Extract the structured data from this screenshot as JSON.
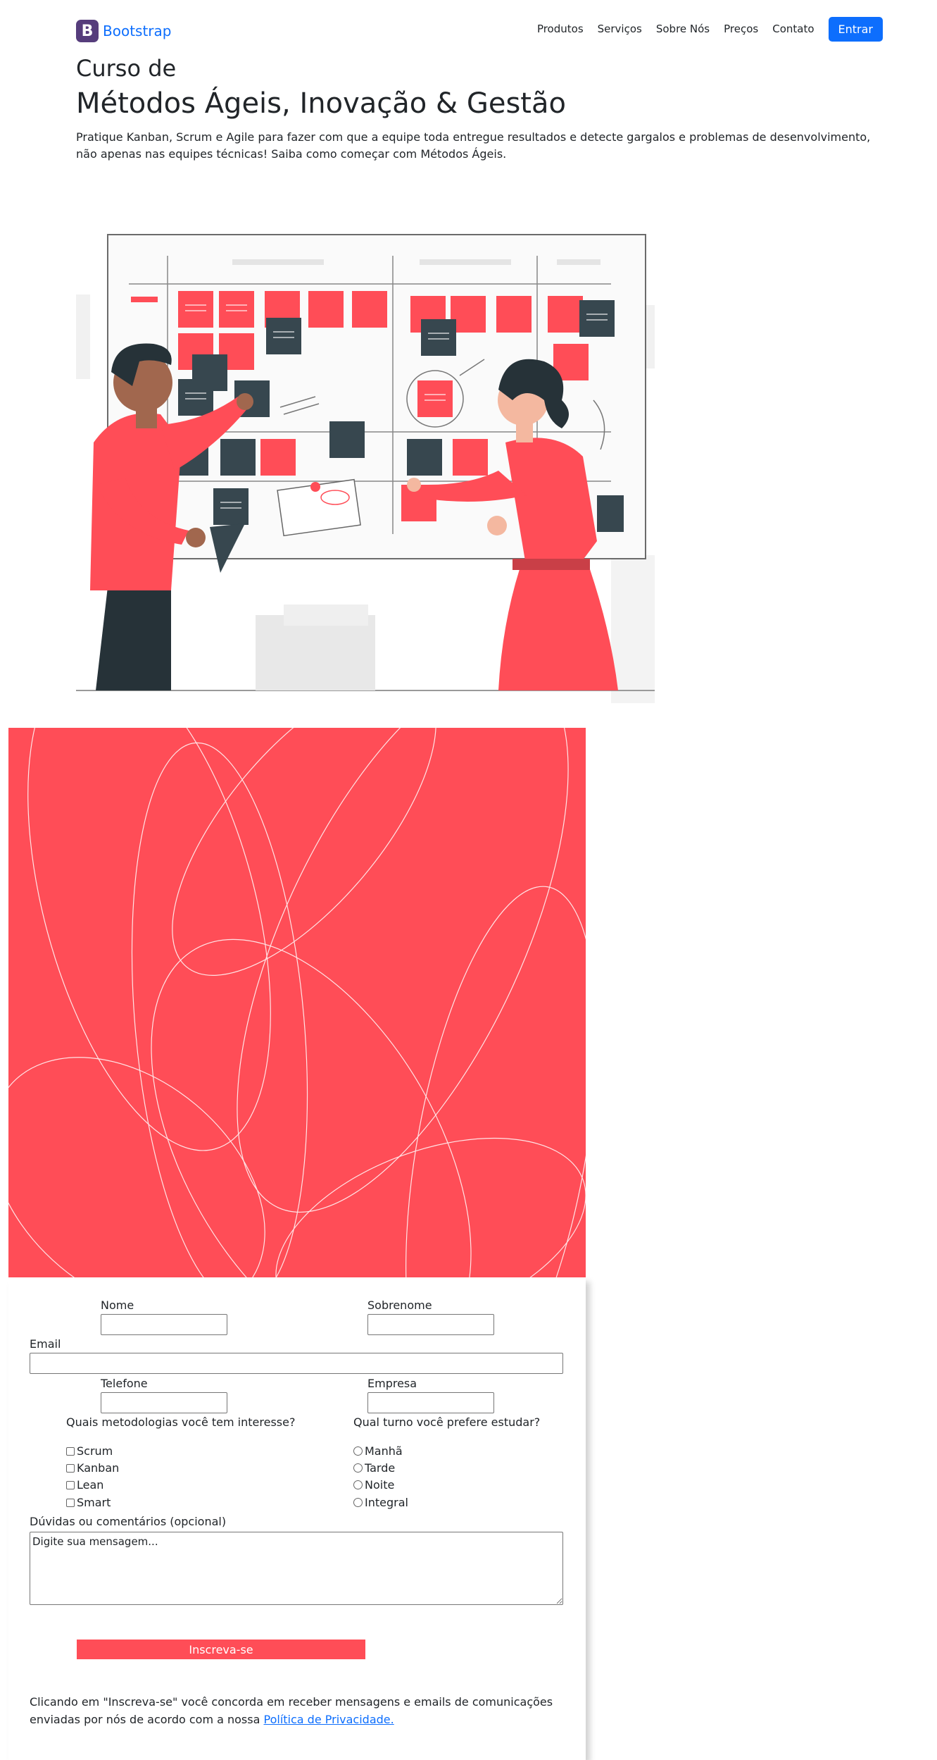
{
  "brand": {
    "logo_letter": "B",
    "name": "Bootstrap",
    "color": "#0d6efd",
    "logo_color": "#563d7c"
  },
  "nav": {
    "items": [
      "Produtos",
      "Serviços",
      "Sobre Nós",
      "Preços",
      "Contato"
    ],
    "login_label": "Entrar"
  },
  "hero": {
    "subtitle": "Curso de",
    "title": "Métodos Ágeis, Inovação & Gestão",
    "lead": "Pratique Kanban, Scrum e Agile para fazer com que a equipe toda entregue resultados e detecte gargalos e problemas de desenvolvimento, não apenas nas equipes técnicas! Saiba como começar com Métodos Ágeis."
  },
  "colors": {
    "accent": "#ff4d57",
    "dark": "#37474f",
    "primary": "#0d6efd"
  },
  "form": {
    "first_name_label": "Nome",
    "last_name_label": "Sobrenome",
    "email_label": "Email",
    "phone_label": "Telefone",
    "company_label": "Empresa",
    "methods_question": "Quais metodologias você tem interesse?",
    "methods": [
      "Scrum",
      "Kanban",
      "Lean",
      "Smart"
    ],
    "shift_question": "Qual turno você prefere estudar?",
    "shifts": [
      "Manhã",
      "Tarde",
      "Noite",
      "Integral"
    ],
    "comments_label": "Dúvidas ou comentários (opcional)",
    "comments_value": "Digite sua mensagem...",
    "submit_label": "Inscreva-se",
    "terms_text": "Clicando em \"Inscreva-se\" você concorda em receber mensagens e emails de comunicações enviadas por nós de acordo com a nossa",
    "privacy_link": "Política de Privacidade."
  }
}
